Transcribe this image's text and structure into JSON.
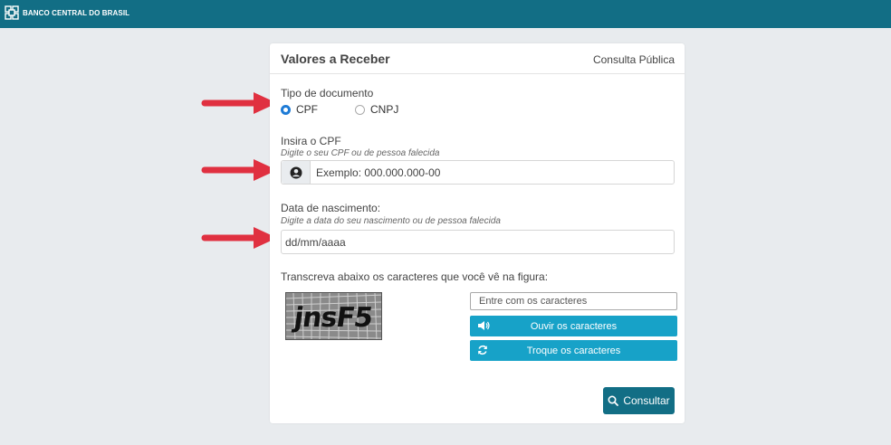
{
  "header": {
    "brand": "BANCO CENTRAL DO BRASIL"
  },
  "card": {
    "title": "Valores a Receber",
    "link": "Consulta Pública"
  },
  "doc_type": {
    "label": "Tipo de documento",
    "options": [
      "CPF",
      "CNPJ"
    ],
    "selected": "CPF"
  },
  "cpf": {
    "label": "Insira o CPF",
    "hint": "Digite o seu CPF ou de pessoa falecida",
    "placeholder": "Exemplo: 000.000.000-00"
  },
  "birth": {
    "label": "Data de nascimento:",
    "hint": "Digite a data do seu nascimento ou de pessoa falecida",
    "placeholder": "dd/mm/aaaa"
  },
  "captcha": {
    "label": "Transcreva abaixo os caracteres que você vê na figura:",
    "image_text": "jnsF5",
    "input_placeholder": "Entre com os caracteres",
    "listen_label": "Ouvir os caracteres",
    "refresh_label": "Troque os caracteres"
  },
  "submit": {
    "label": "Consultar"
  },
  "colors": {
    "topbar": "#126e85",
    "primary": "#126e85",
    "info": "#17a2c8",
    "arrow": "#e03040",
    "radio": "#1e7bd6"
  },
  "icons": [
    "bcb-logo-icon",
    "user-circle-icon",
    "volume-icon",
    "refresh-icon",
    "search-icon",
    "arrow-icon"
  ]
}
